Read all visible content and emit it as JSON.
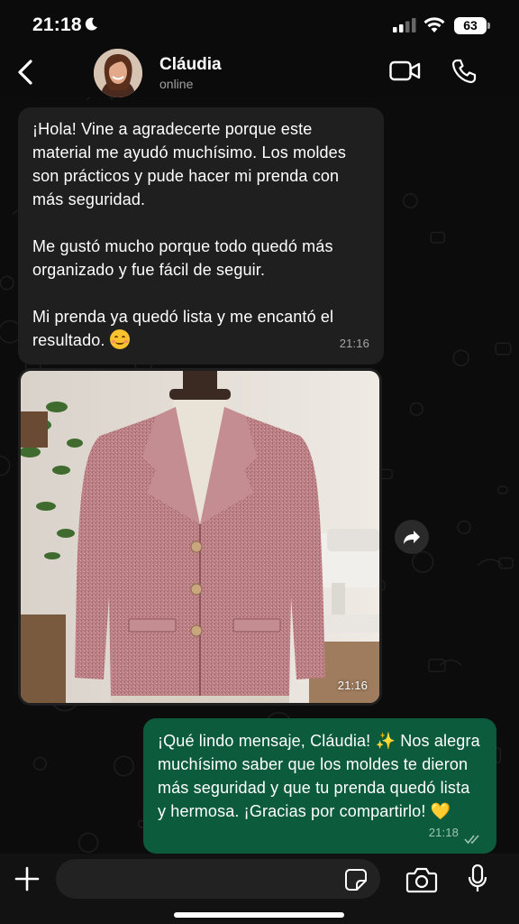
{
  "status_bar": {
    "time": "21:18",
    "battery": "63"
  },
  "header": {
    "contact_name": "Cláudia",
    "contact_status": "online"
  },
  "messages": [
    {
      "direction": "incoming",
      "paragraphs": [
        "¡Hola! Vine a agradecerte porque este material me ayudó muchísimo. Los moldes son prácticos y pude hacer mi prenda con más seguridad.",
        "Me gustó mucho porque todo quedó más organizado y fue fácil de seguir.",
        "Mi prenda ya quedó lista y me encantó el resultado."
      ],
      "emoji": "smiling-face-icon",
      "time": "21:16"
    },
    {
      "direction": "incoming",
      "type": "image",
      "image": "pink tweed blazer on dress form",
      "time": "21:16"
    },
    {
      "direction": "outgoing",
      "text_a": "¡Qué lindo mensaje, Cláudia!",
      "sparkle": "✨",
      "text_b": "Nos alegra muchísimo saber que los moldes te dieron más seguridad y que tu prenda quedó lista y hermosa. ¡Gracias por compartirlo!",
      "heart": "💛",
      "time": "21:18",
      "read": true
    }
  ],
  "composer": {
    "placeholder": ""
  },
  "colors": {
    "outgoing_bubble": "#0c5b3c",
    "incoming_bubble": "#1f1f1f",
    "background": "#0b0b0b"
  }
}
